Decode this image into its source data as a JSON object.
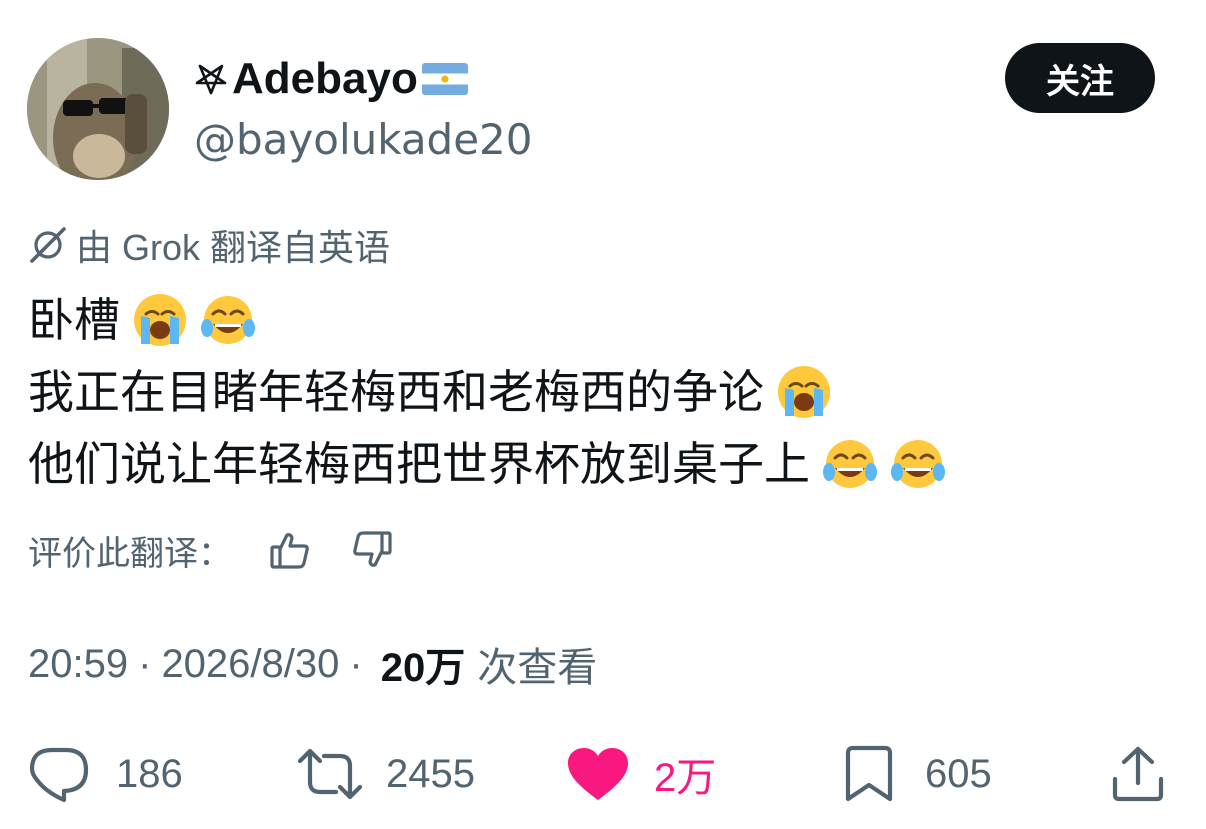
{
  "author": {
    "display_name": "Adebayo",
    "name_prefix_icon": "pentagram-icon",
    "name_suffix_icon": "argentina-flag-icon",
    "handle": "@bayolukade20",
    "avatar_icon": "avatar-sunglasses-icon"
  },
  "follow_label": "关注",
  "translation_note": {
    "icon": "grok-icon",
    "text": "由 Grok 翻译自英语"
  },
  "tweet": {
    "lines": [
      {
        "text": "卧槽",
        "emojis": [
          "loudly-crying-emoji",
          "tears-of-joy-emoji"
        ]
      },
      {
        "text": "我正在目睹年轻梅西和老梅西的争论",
        "emojis": [
          "loudly-crying-emoji"
        ]
      },
      {
        "text": "他们说让年轻梅西把世界杯放到桌子上",
        "emojis": [
          "tears-of-joy-emoji",
          "tears-of-joy-emoji"
        ]
      }
    ]
  },
  "rate_translation_label": "评价此翻译：",
  "meta": {
    "time": "20:59",
    "separator": "·",
    "date": "2026/8/30",
    "views_count": "20万",
    "views_label": "次查看"
  },
  "actions": {
    "replies": "186",
    "reposts": "2455",
    "likes": "2万",
    "bookmarks": "605"
  },
  "colors": {
    "text_primary": "#0f1419",
    "text_secondary": "#536471",
    "like_accent": "#f91880",
    "follow_button_bg": "#0f1419"
  }
}
